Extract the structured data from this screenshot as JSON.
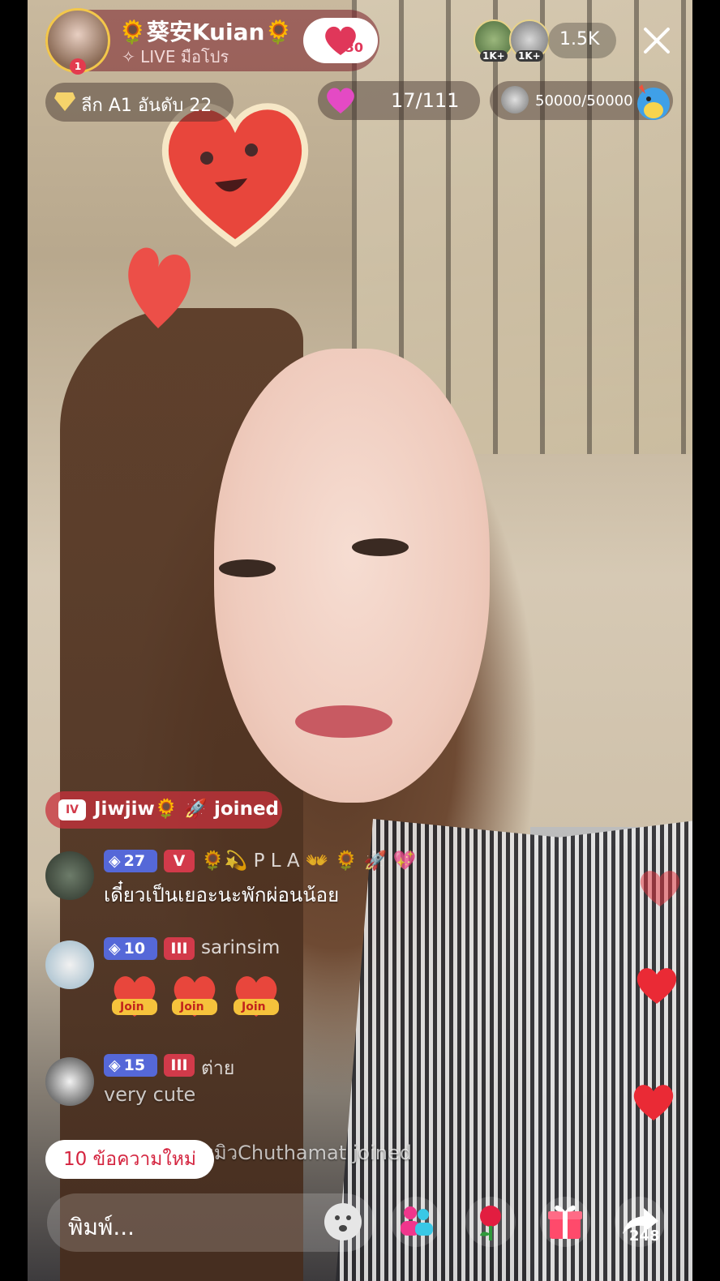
{
  "host": {
    "name": "🌻葵安Kuian🌻",
    "subtitle": "✧ LIVE มือโปร",
    "follow_count": "30",
    "avatar_badge": "1"
  },
  "viewers": {
    "avatar_badges": [
      "1K+",
      "1K+"
    ],
    "count": "1.5K"
  },
  "stats": {
    "league": "ลีก A1 อันดับ 22",
    "goal": "17/111",
    "target": "50000/50000"
  },
  "chat": {
    "joined_banner": {
      "badge": "IV",
      "text": "Jiwjiw🌻 🚀 joined"
    },
    "messages": [
      {
        "gem_level": "27",
        "fan_badge": "V",
        "name": "🌻💫 P L A 👐 🌻 🚀 💖",
        "text": "เดี๋ยวเป็นเยอะนะพักผ่อนน้อย"
      },
      {
        "gem_level": "10",
        "fan_badge": "III",
        "name": "sarinsim",
        "stickers": [
          "Join",
          "Join",
          "Join"
        ]
      },
      {
        "gem_level": "15",
        "fan_badge": "III",
        "name": "ต่าย",
        "text": "very cute"
      },
      {
        "name": "หมิวChuthamat joined"
      }
    ],
    "new_messages": "10 ข้อความใหม่"
  },
  "bottom_bar": {
    "input_placeholder": "พิมพ์...",
    "share_count": "248"
  },
  "colors": {
    "accent_red": "#e0375a",
    "gem_badge": "#5568d8",
    "fan_badge": "#d23a4a"
  }
}
